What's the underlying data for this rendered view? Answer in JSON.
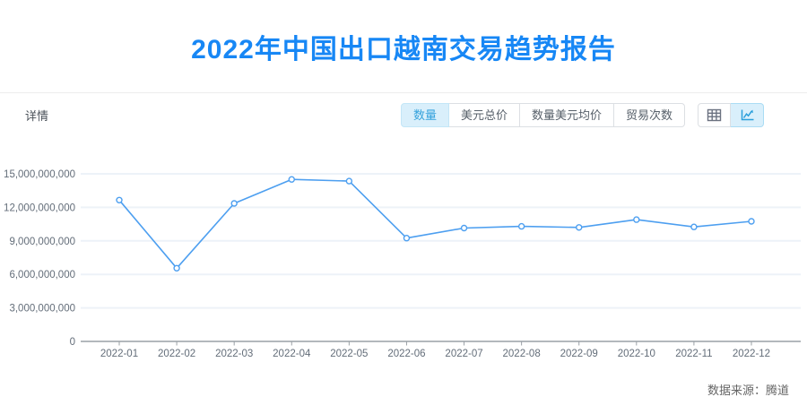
{
  "header": {
    "title": "2022年中国出口越南交易趋势报告"
  },
  "toolbar": {
    "details_label": "详情",
    "tabs": [
      {
        "label": "数量",
        "active": true
      },
      {
        "label": "美元总价",
        "active": false
      },
      {
        "label": "数量美元均价",
        "active": false
      },
      {
        "label": "贸易次数",
        "active": false
      }
    ],
    "view_toggles": [
      {
        "name": "table-view",
        "icon": "table-icon",
        "active": false
      },
      {
        "name": "chart-view",
        "icon": "line-chart-icon",
        "active": true
      }
    ]
  },
  "chart_data": {
    "type": "line",
    "title": "",
    "xlabel": "",
    "ylabel": "",
    "categories": [
      "2022-01",
      "2022-02",
      "2022-03",
      "2022-04",
      "2022-05",
      "2022-06",
      "2022-07",
      "2022-08",
      "2022-09",
      "2022-10",
      "2022-11",
      "2022-12"
    ],
    "values": [
      12650000000,
      6550000000,
      12350000000,
      14500000000,
      14350000000,
      9250000000,
      10150000000,
      10300000000,
      10200000000,
      10900000000,
      10250000000,
      10750000000
    ],
    "ylim": [
      0,
      15000000000
    ],
    "yticks": [
      {
        "value": 15000000000,
        "label": "15,000,000,000"
      },
      {
        "value": 12000000000,
        "label": "12,000,000,000"
      },
      {
        "value": 9000000000,
        "label": "9,000,000,000"
      },
      {
        "value": 6000000000,
        "label": "6,000,000,000"
      },
      {
        "value": 3000000000,
        "label": "3,000,000,000"
      },
      {
        "value": 0,
        "label": "0"
      }
    ],
    "grid": true,
    "legend": "none",
    "marker": "hollow-circle"
  },
  "footer": {
    "source": "数据来源：腾道"
  },
  "colors": {
    "title": "#1787f5",
    "tab_active_bg": "#d9effb",
    "tab_active_fg": "#36a3dc",
    "tab_fg": "#57606a",
    "tab_border": "#dcdfe3",
    "line": "#4d9ff0",
    "grid": "#edf2f8",
    "axis": "#9aa0a6",
    "tick_label": "#636d79",
    "icon_gray": "#6b7280"
  }
}
